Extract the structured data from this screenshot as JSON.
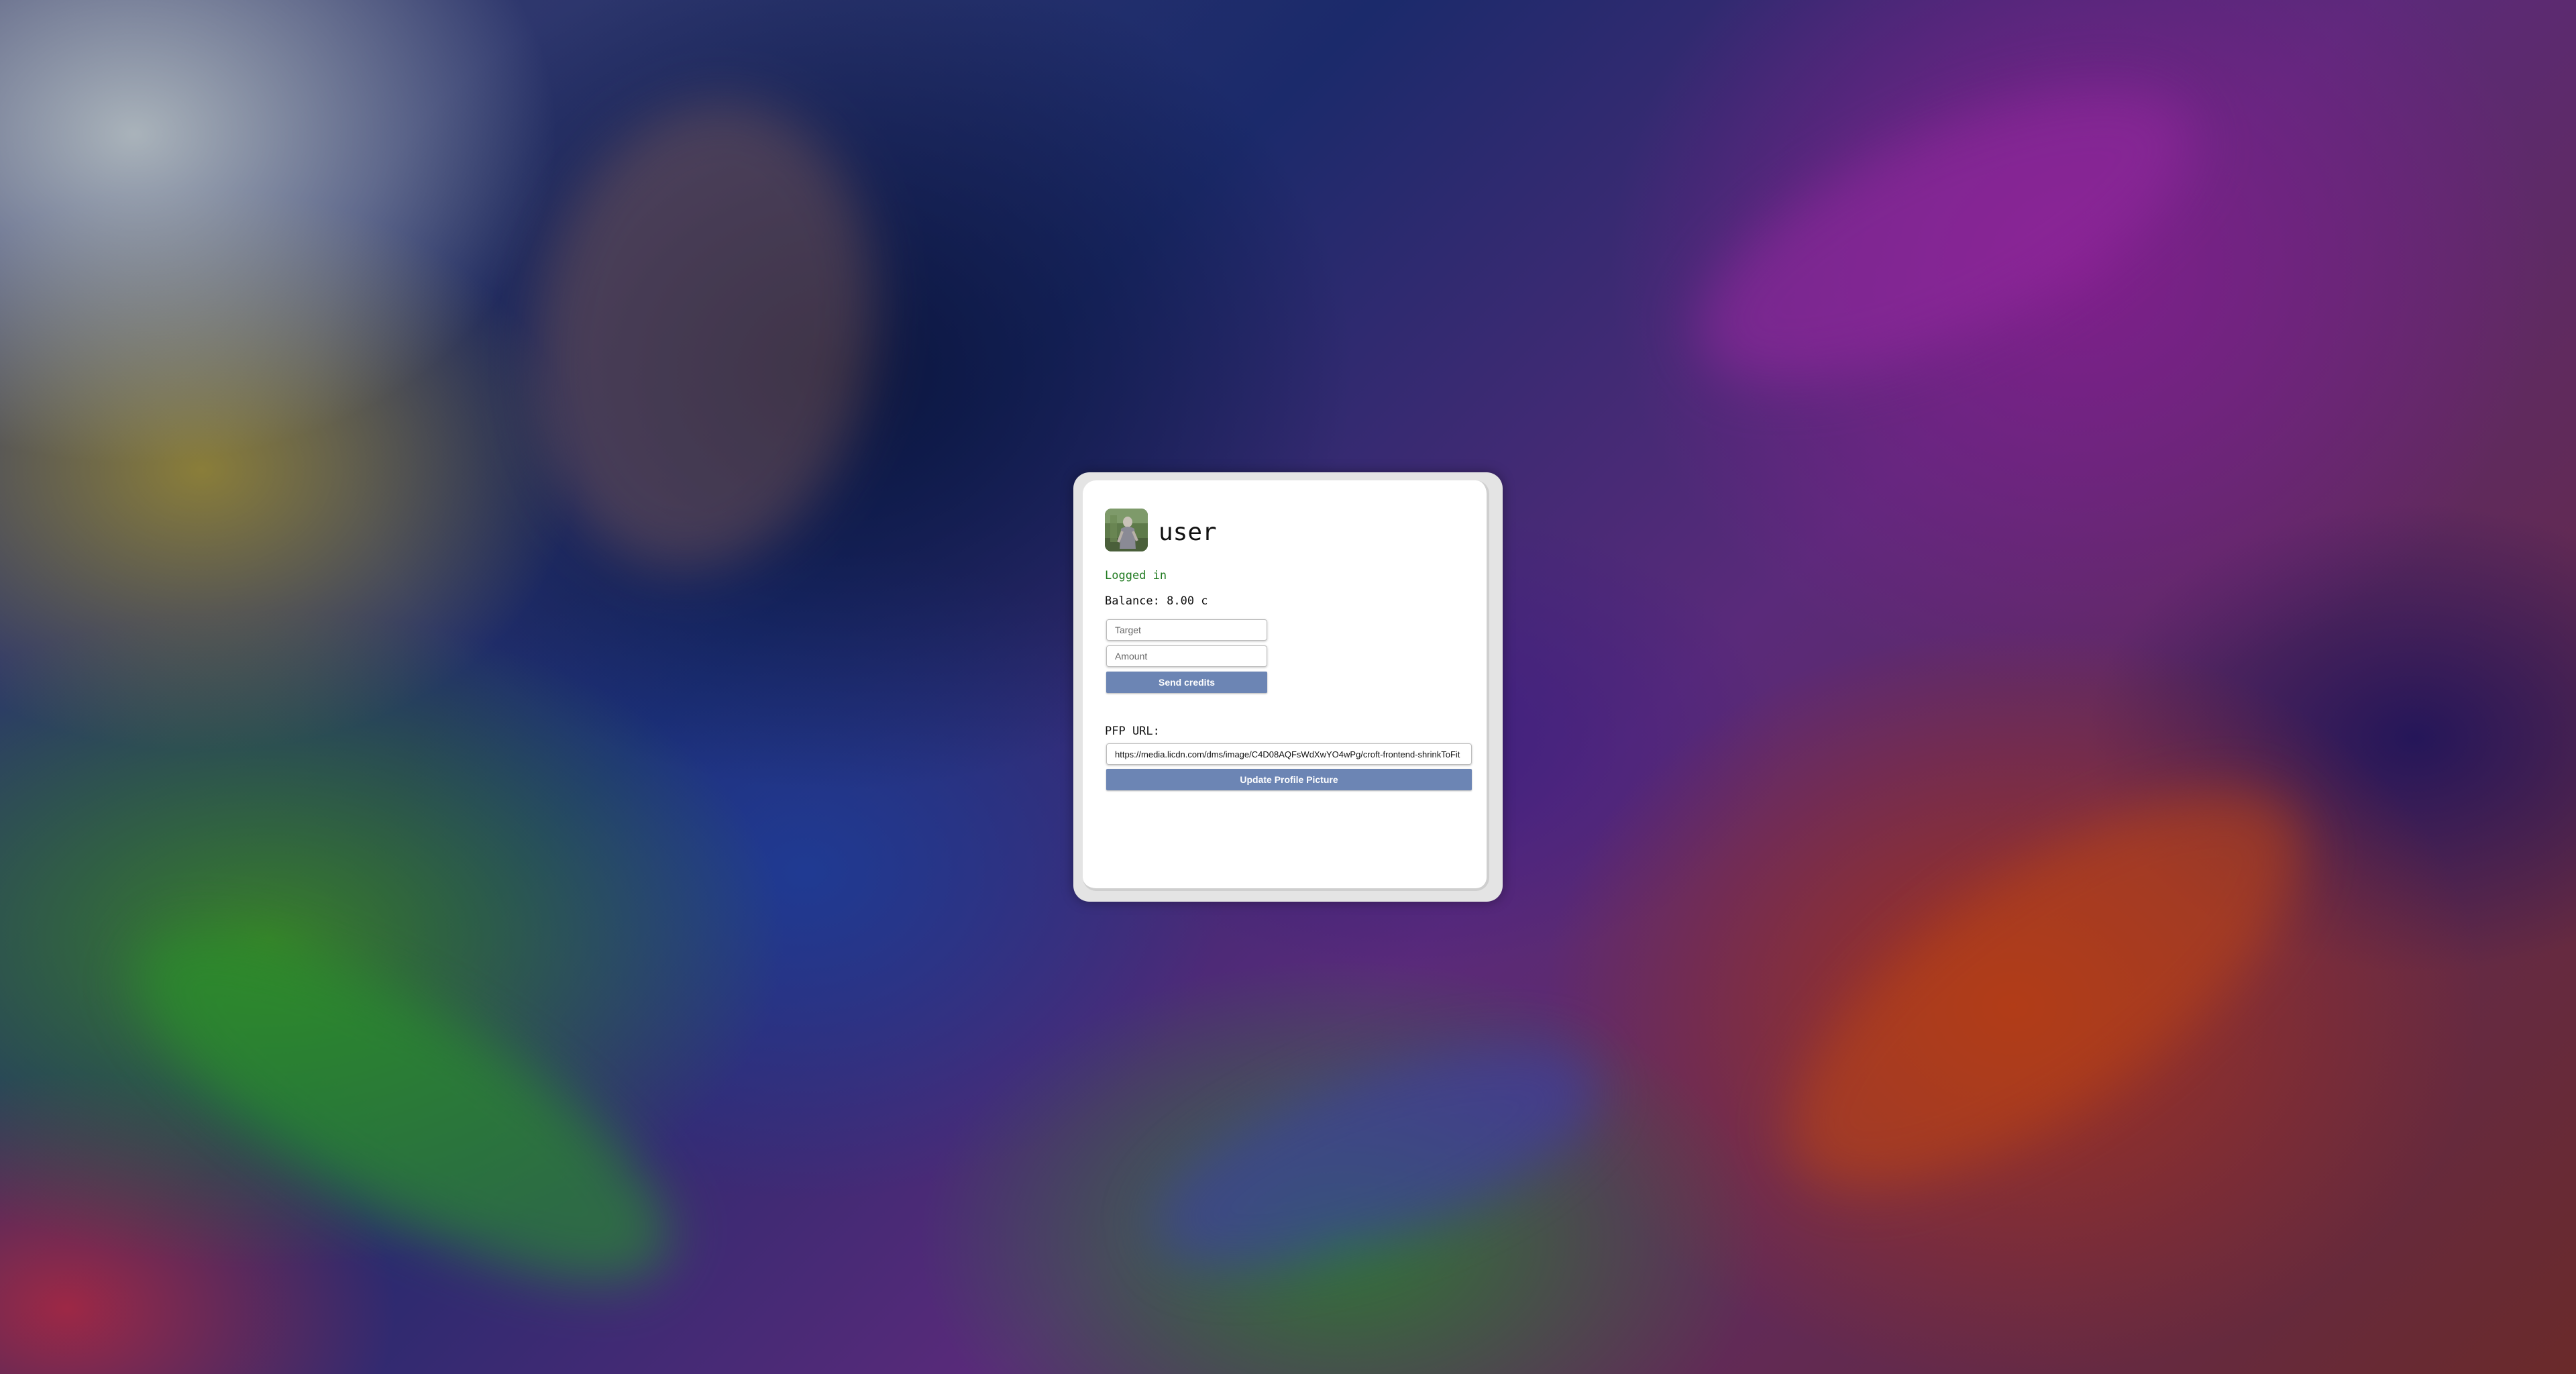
{
  "profile": {
    "username": "user",
    "status": "Logged in",
    "balance_label": "Balance: 8.00 c"
  },
  "transfer": {
    "target_placeholder": "Target",
    "amount_placeholder": "Amount",
    "send_label": "Send credits"
  },
  "pfp": {
    "label": "PFP URL:",
    "url_value": "https://media.licdn.com/dms/image/C4D08AQFsWdXwYO4wPg/croft-frontend-shrinkToFit",
    "update_label": "Update Profile Picture"
  },
  "colors": {
    "accent": "#6c85b4",
    "status_green": "#1f7a1f"
  }
}
